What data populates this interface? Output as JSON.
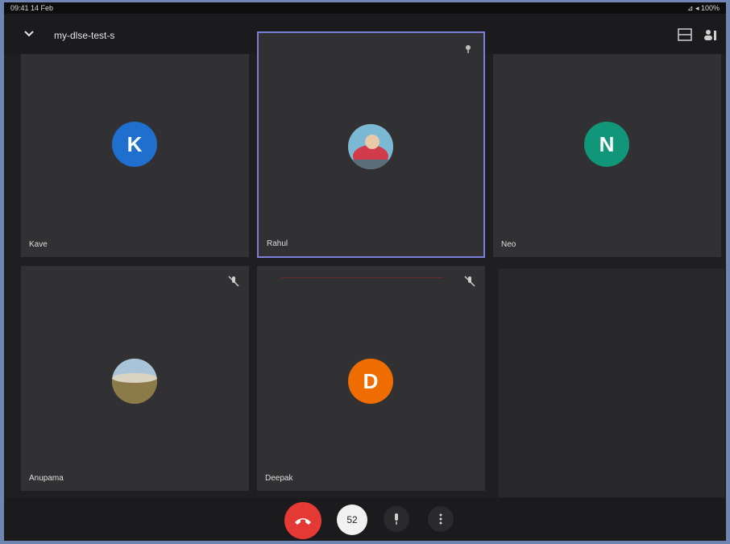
{
  "status_bar": {
    "left_text": "09:41  14 Feb",
    "right_text": "⊿ ◂ 100%"
  },
  "meeting": {
    "title": "my-dlse-test-s"
  },
  "participants": [
    {
      "name": "Kave",
      "initial": "K",
      "color": "#1f6fcf"
    },
    {
      "name": "Rahul",
      "initial": "",
      "color": "#c24b4b"
    },
    {
      "name": "Neo",
      "initial": "N",
      "color": "#12967a"
    },
    {
      "name": "Anupama",
      "initial": "",
      "color": "#9a8d6a"
    },
    {
      "name": "Deepak",
      "initial": "D",
      "color": "#ef6c00"
    }
  ],
  "controls": {
    "reaction_count": "52"
  },
  "icons": {
    "back": "chevron-down-icon",
    "pin": "pin-icon",
    "layout": "layout-icon",
    "participants": "people-icon",
    "mute": "mic-off-icon",
    "end": "call-end-icon",
    "mic": "mic-icon",
    "more": "more-vert-icon"
  }
}
